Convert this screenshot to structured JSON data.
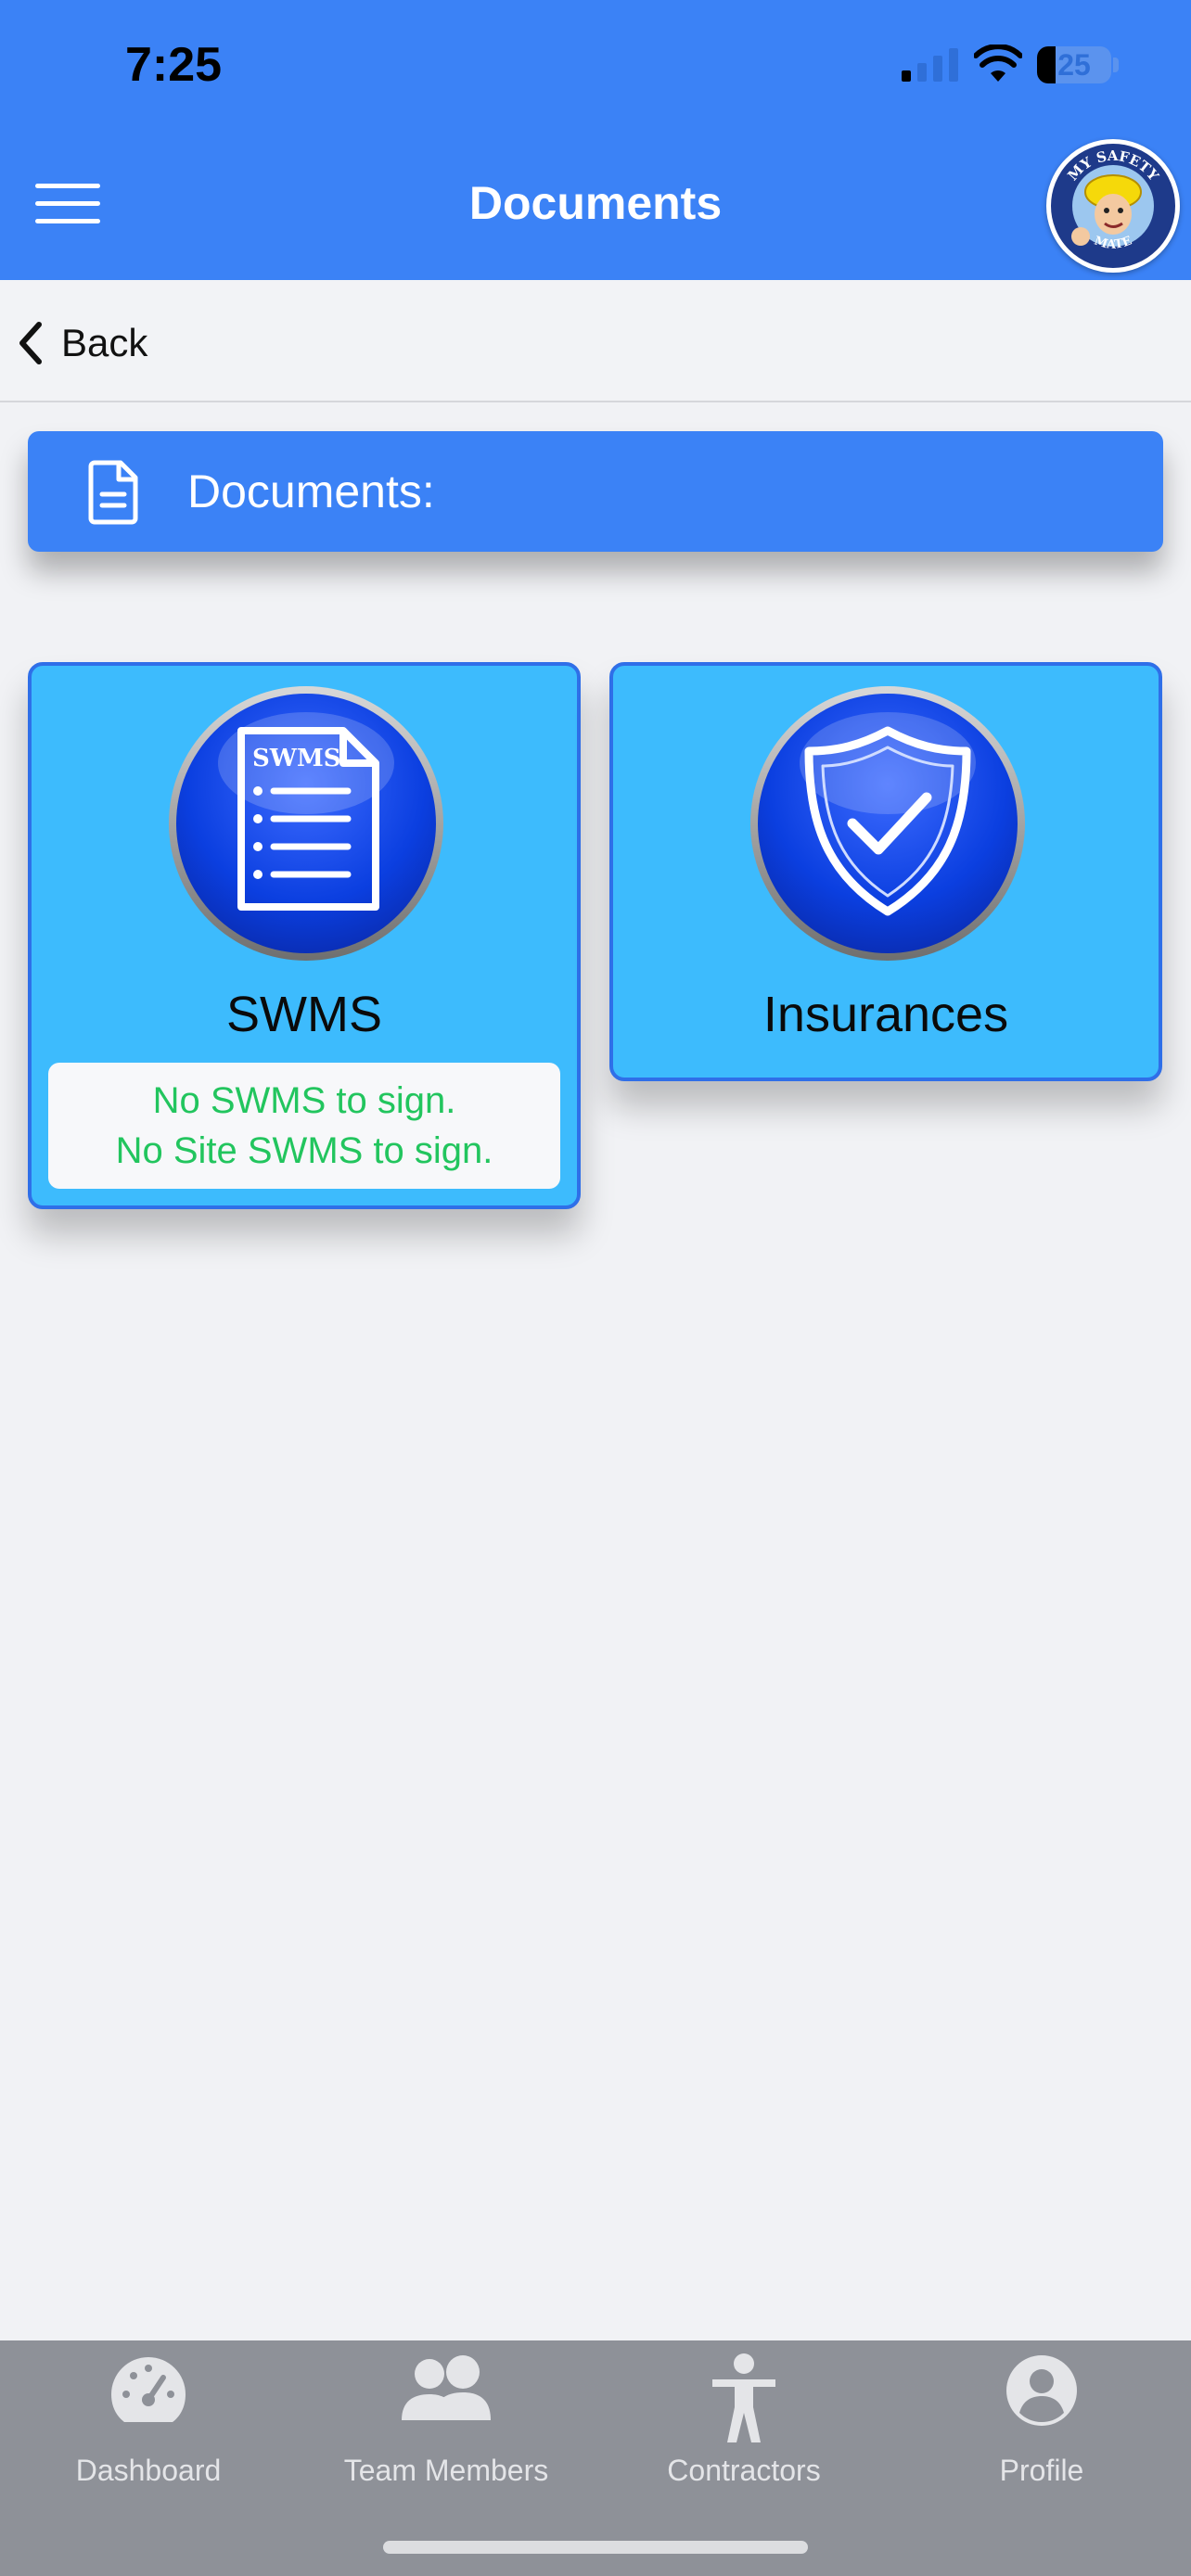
{
  "status_bar": {
    "time": "7:25",
    "battery": "25",
    "battery_level": 0.25
  },
  "header": {
    "title": "Documents",
    "logo_top_text": "MY SAFETY",
    "logo_bottom_text": "MATE"
  },
  "back": {
    "label": "Back"
  },
  "section": {
    "title": "Documents:"
  },
  "cards": [
    {
      "label": "SWMS",
      "icon_text": "SWMS",
      "icon": "swms-document-icon",
      "status_lines": [
        "No SWMS to sign.",
        "No Site SWMS to sign."
      ]
    },
    {
      "label": "Insurances",
      "icon": "shield-check-icon"
    }
  ],
  "nav": [
    {
      "label": "Dashboard",
      "icon": "speedometer-icon"
    },
    {
      "label": "Team Members",
      "icon": "people-icon"
    },
    {
      "label": "Contractors",
      "icon": "person-icon"
    },
    {
      "label": "Profile",
      "icon": "profile-icon"
    }
  ],
  "colors": {
    "header": "#3b82f6",
    "card": "#3dbbfd",
    "card_border": "#2f6fe8",
    "status_text": "#22c55e",
    "nav_bg": "#8e9198"
  }
}
